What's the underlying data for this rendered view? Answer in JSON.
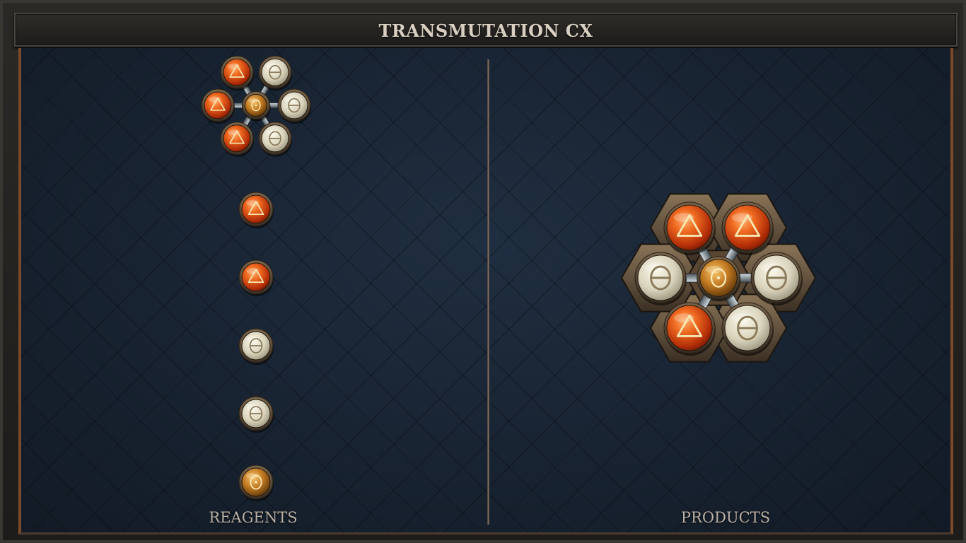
{
  "window": {
    "title": "TRANSMUTATION CX"
  },
  "panels": {
    "reagents_label": "REAGENTS",
    "products_label": "PRODUCTS"
  },
  "symbols": {
    "fire": "fire-triangle-icon",
    "salt": "theta-circle-icon",
    "core": "circle-dot-icon"
  },
  "colors": {
    "fire": "#e05a1c",
    "salt": "#ddd8c2",
    "core": "#c27a22",
    "metal": "#8b7556"
  },
  "reagents": {
    "molecule": {
      "center": "core",
      "atoms": [
        "fire",
        "salt",
        "salt",
        "salt",
        "fire",
        "fire"
      ]
    },
    "atoms": [
      "fire",
      "fire",
      "salt",
      "salt",
      "core"
    ]
  },
  "products": {
    "molecule": {
      "center": "core",
      "atoms": [
        "fire",
        "fire",
        "salt",
        "salt",
        "fire",
        "salt"
      ]
    }
  }
}
